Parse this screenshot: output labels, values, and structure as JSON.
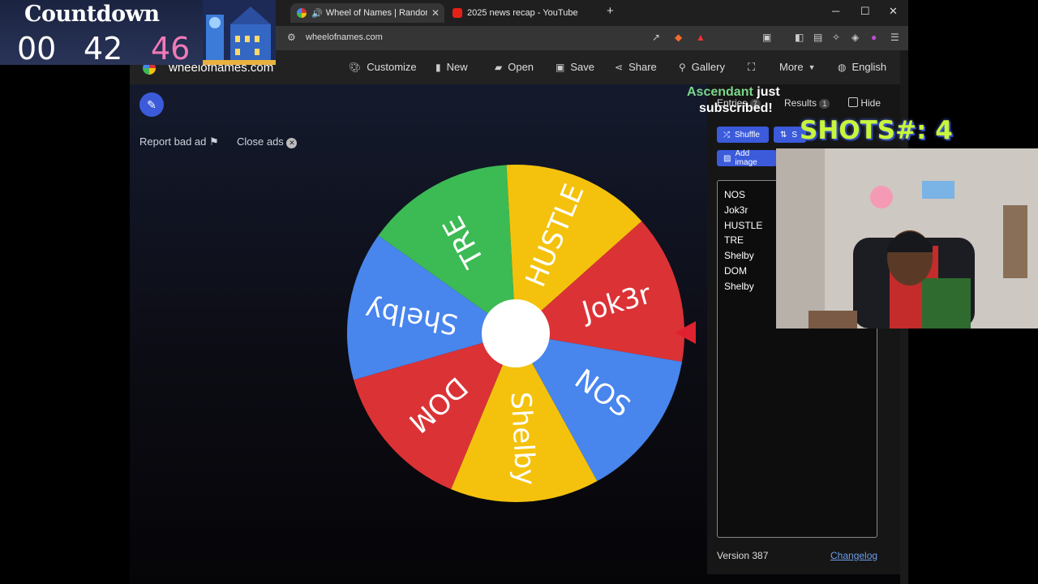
{
  "countdown": {
    "title": "Countdown",
    "values": [
      "00",
      "42",
      "46"
    ]
  },
  "browser": {
    "tabs": [
      {
        "label": "Wheel of Names | Random na",
        "active": true
      },
      {
        "label": "2025 news recap - YouTube",
        "active": false
      }
    ],
    "url": "wheelofnames.com"
  },
  "site": {
    "logo": "wheelofnames.com",
    "nav": [
      "Customize",
      "New",
      "Open",
      "Save",
      "Share",
      "Gallery",
      "More",
      "English"
    ]
  },
  "ads": {
    "report": "Report bad ad",
    "close": "Close ads"
  },
  "wheel": {
    "segments": [
      {
        "label": "Jok3r",
        "color": "#db3236"
      },
      {
        "label": "NOS",
        "color": "#4885ed"
      },
      {
        "label": "Shelby",
        "color": "#f4c20d"
      },
      {
        "label": "DOM",
        "color": "#db3236"
      },
      {
        "label": "Shelby",
        "color": "#4885ed"
      },
      {
        "label": "TRE",
        "color": "#3cba54"
      },
      {
        "label": "HUSTLE",
        "color": "#f4c20d"
      }
    ]
  },
  "panel": {
    "tabs": {
      "entries": "Entries",
      "entries_count": "7",
      "results": "Results",
      "results_count": "1",
      "hide": "Hide"
    },
    "buttons": {
      "shuffle": "Shuffle",
      "sort": "S",
      "add_image": "Add image"
    },
    "entries": [
      "NOS",
      "Jok3r",
      "HUSTLE",
      "TRE",
      "Shelby",
      "DOM",
      "Shelby"
    ],
    "version": "Version 387",
    "changelog": "Changelog"
  },
  "overlay": {
    "sub_name": "Ascendant",
    "sub_text1": " just",
    "sub_text2": "subscribed!",
    "shots": "SHOTS#: 4"
  }
}
